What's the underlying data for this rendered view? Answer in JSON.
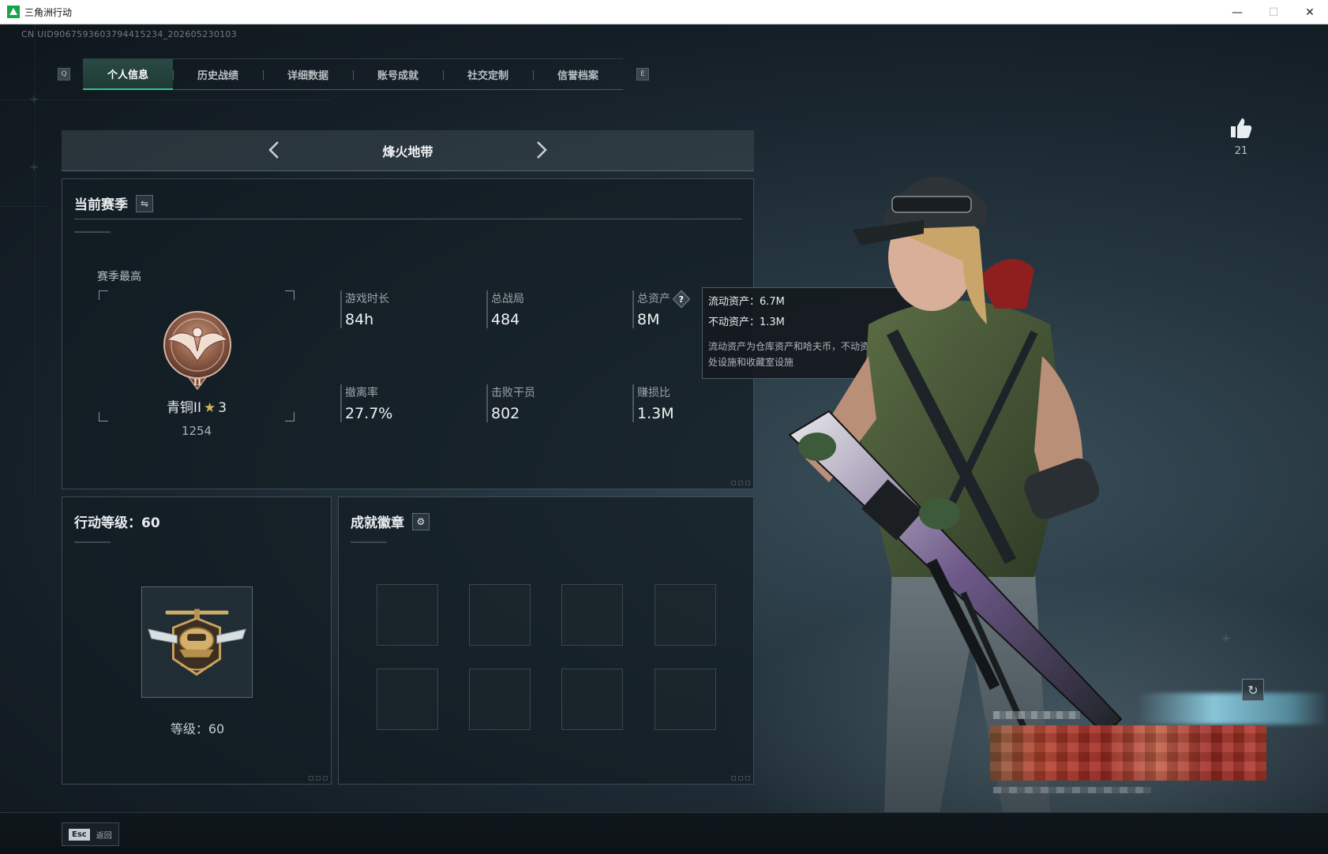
{
  "window": {
    "title": "三角洲行动",
    "minimize": "—",
    "maximize": "☐",
    "close": "✕"
  },
  "uid": "CN UID9067593603794415234_202605230103",
  "tabs": {
    "left_key": "Q",
    "right_key": "E",
    "items": [
      "个人信息",
      "历史战绩",
      "详细数据",
      "账号成就",
      "社交定制",
      "信誉档案"
    ],
    "active_index": 0
  },
  "mode": {
    "title": "烽火地带"
  },
  "season": {
    "title": "当前赛季",
    "switch_icon": "⇋",
    "best_label": "赛季最高",
    "rank_name": "青铜II",
    "rank_star": "★",
    "rank_stars_count": "3",
    "rank_score": "1254",
    "stats": [
      {
        "label": "游戏时长",
        "value": "84h"
      },
      {
        "label": "总战局",
        "value": "484"
      },
      {
        "label": "总资产",
        "value": "8M",
        "help": "?"
      },
      {
        "label": "撤离率",
        "value": "27.7%"
      },
      {
        "label": "击败干员",
        "value": "802"
      },
      {
        "label": "赚损比",
        "value": "1.3M"
      }
    ]
  },
  "tooltip": {
    "liquid": "流动资产：6.7M",
    "fixed": "不动资产：1.3M",
    "note": "流动资产为仓库资产和哈夫币，不动资产为特勤处设施和收藏室设施"
  },
  "level": {
    "title": "行动等级：60",
    "label": "等级：60"
  },
  "achievements": {
    "title": "成就徽章",
    "settings_icon": "⚙"
  },
  "likes": {
    "count": "21"
  },
  "refresh_icon": "↻",
  "footer": {
    "esc_key": "Esc",
    "back_label": "返回"
  },
  "colors": {
    "accent": "#35c28a",
    "background": "#151f27",
    "panel": "#121c23",
    "rank_bronze": "#a0705a"
  },
  "icons": {
    "app": "delta-force-logo",
    "like": "thumbs-up-icon",
    "prev": "chevron-left-icon",
    "next": "chevron-right-icon"
  }
}
